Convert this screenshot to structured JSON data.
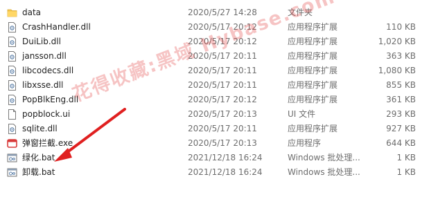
{
  "files": [
    {
      "icon": "folder-icon",
      "name": "data",
      "date": "2020/5/27 14:28",
      "type": "文件夹",
      "size": ""
    },
    {
      "icon": "dll-file-icon",
      "name": "CrashHandler.dll",
      "date": "2020/5/17 20:12",
      "type": "应用程序扩展",
      "size": "110 KB"
    },
    {
      "icon": "dll-file-icon",
      "name": "DuiLib.dll",
      "date": "2020/5/17 20:12",
      "type": "应用程序扩展",
      "size": "1,020 KB"
    },
    {
      "icon": "dll-file-icon",
      "name": "jansson.dll",
      "date": "2020/5/17 20:11",
      "type": "应用程序扩展",
      "size": "363 KB"
    },
    {
      "icon": "dll-file-icon",
      "name": "libcodecs.dll",
      "date": "2020/5/17 20:11",
      "type": "应用程序扩展",
      "size": "1,080 KB"
    },
    {
      "icon": "dll-file-icon",
      "name": "libxsse.dll",
      "date": "2020/5/17 20:11",
      "type": "应用程序扩展",
      "size": "855 KB"
    },
    {
      "icon": "dll-file-icon",
      "name": "PopBlkEng.dll",
      "date": "2020/5/17 20:12",
      "type": "应用程序扩展",
      "size": "361 KB"
    },
    {
      "icon": "ui-file-icon",
      "name": "popblock.ui",
      "date": "2020/5/17 20:13",
      "type": "UI 文件",
      "size": "293 KB"
    },
    {
      "icon": "dll-file-icon",
      "name": "sqlite.dll",
      "date": "2020/5/17 20:11",
      "type": "应用程序扩展",
      "size": "927 KB"
    },
    {
      "icon": "app-exe-icon",
      "name": "弹窗拦截.exe",
      "date": "2020/5/17 20:13",
      "type": "应用程序",
      "size": "644 KB"
    },
    {
      "icon": "batch-file-icon",
      "name": "绿化.bat",
      "date": "2021/12/18 16:24",
      "type": "Windows 批处理...",
      "size": "1 KB"
    },
    {
      "icon": "batch-file-icon",
      "name": "卸载.bat",
      "date": "2021/12/18 16:24",
      "type": "Windows 批处理...",
      "size": "1 KB"
    }
  ],
  "watermark": {
    "text": "花得收藏:黑域 Hybase.com"
  },
  "colors": {
    "accent_arrow": "#e02020",
    "folder": "#f3c64e",
    "exe_red": "#d83a3a"
  }
}
